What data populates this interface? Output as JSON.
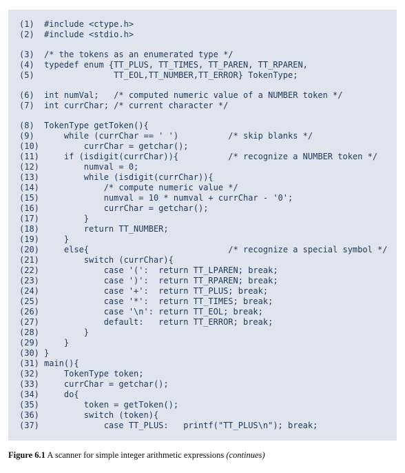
{
  "code_lines": [
    {
      "n": "(1)",
      "text": "#include <ctype.h>"
    },
    {
      "n": "(2)",
      "text": "#include <stdio.h>"
    },
    {
      "n": "",
      "text": ""
    },
    {
      "n": "(3)",
      "text": "/* the tokens as an enumerated type */"
    },
    {
      "n": "(4)",
      "text": "typedef enum {TT_PLUS, TT_TIMES, TT_PAREN, TT_RPAREN,"
    },
    {
      "n": "(5)",
      "text": "              TT_EOL,TT_NUMBER,TT_ERROR} TokenType;"
    },
    {
      "n": "",
      "text": ""
    },
    {
      "n": "(6)",
      "text": "int numVal;   /* computed numeric value of a NUMBER token */"
    },
    {
      "n": "(7)",
      "text": "int currChar; /* current character */"
    },
    {
      "n": "",
      "text": ""
    },
    {
      "n": "(8)",
      "text": "TokenType getToken(){"
    },
    {
      "n": "(9)",
      "text": "    while (currChar == ' ')          /* skip blanks */"
    },
    {
      "n": "(10)",
      "text": "        currChar = getchar();"
    },
    {
      "n": "(11)",
      "text": "    if (isdigit(currChar)){          /* recognize a NUMBER token */"
    },
    {
      "n": "(12)",
      "text": "        numval = 0;"
    },
    {
      "n": "(13)",
      "text": "        while (isdigit(currChar)){"
    },
    {
      "n": "(14)",
      "text": "            /* compute numeric value */"
    },
    {
      "n": "(15)",
      "text": "            numval = 10 * numval + currChar - '0';"
    },
    {
      "n": "(16)",
      "text": "            currChar = getchar();"
    },
    {
      "n": "(17)",
      "text": "        }"
    },
    {
      "n": "(18)",
      "text": "        return TT_NUMBER;"
    },
    {
      "n": "(19)",
      "text": "    }"
    },
    {
      "n": "(20)",
      "text": "    else{                            /* recognize a special symbol */"
    },
    {
      "n": "(21)",
      "text": "        switch (currChar){"
    },
    {
      "n": "(22)",
      "text": "            case '(':  return TT_LPAREN; break;"
    },
    {
      "n": "(23)",
      "text": "            case ')':  return TT_RPAREN; break;"
    },
    {
      "n": "(24)",
      "text": "            case '+':  return TT_PLUS; break;"
    },
    {
      "n": "(25)",
      "text": "            case '*':  return TT_TIMES; break;"
    },
    {
      "n": "(26)",
      "text": "            case '\\n': return TT_EOL; break;"
    },
    {
      "n": "(27)",
      "text": "            default:   return TT_ERROR; break;"
    },
    {
      "n": "(28)",
      "text": "        }"
    },
    {
      "n": "(29)",
      "text": "    }"
    },
    {
      "n": "(30)",
      "text": "}"
    },
    {
      "n": "(31)",
      "text": "main(){"
    },
    {
      "n": "(32)",
      "text": "    TokenType token;"
    },
    {
      "n": "(33)",
      "text": "    currChar = getchar();"
    },
    {
      "n": "(34)",
      "text": "    do{"
    },
    {
      "n": "(35)",
      "text": "        token = getToken();"
    },
    {
      "n": "(36)",
      "text": "        switch (token){"
    },
    {
      "n": "(37)",
      "text": "            case TT_PLUS:   printf(\"TT_PLUS\\n\"); break;"
    }
  ],
  "caption": {
    "label": "Figure 6.1",
    "text": " A scanner for simple integer arithmetic expressions ",
    "continues": "(continues)"
  }
}
